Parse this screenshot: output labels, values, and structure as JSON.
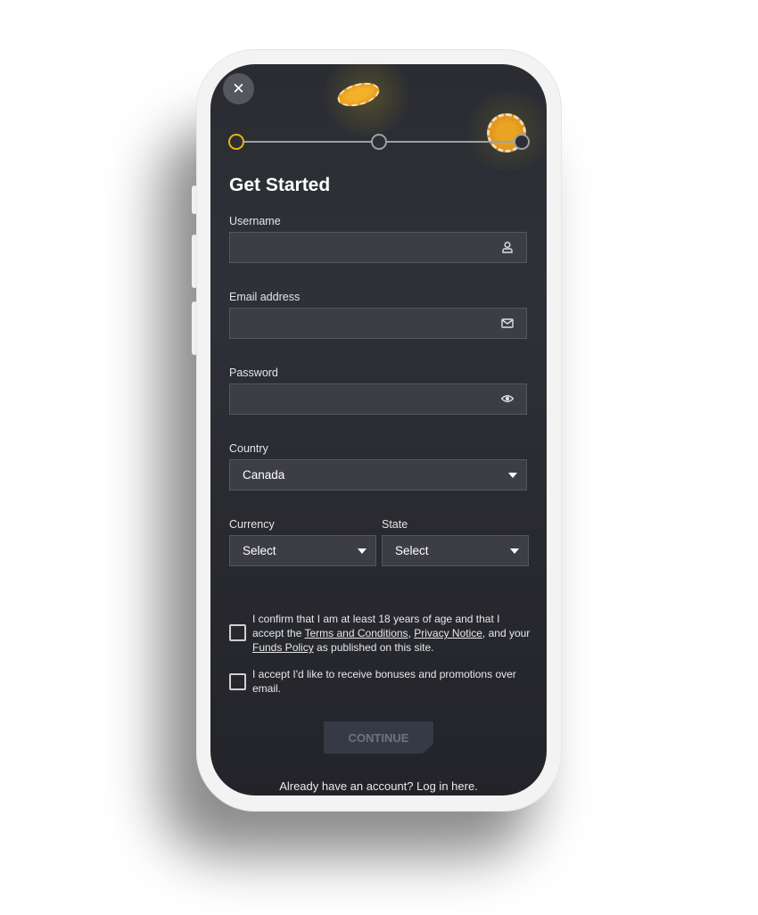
{
  "close_button": {
    "icon": "close-icon",
    "glyph": "✕"
  },
  "stepper": {
    "steps": 3,
    "current_step": 1,
    "active_color": "#e8b415"
  },
  "title": "Get Started",
  "form": {
    "username": {
      "label": "Username",
      "value": "",
      "icon": "user-icon"
    },
    "email": {
      "label": "Email address",
      "value": "",
      "icon": "mail-icon"
    },
    "password": {
      "label": "Password",
      "value": "",
      "icon": "eye-icon"
    },
    "country": {
      "label": "Country",
      "value": "Canada"
    },
    "currency": {
      "label": "Currency",
      "value": "Select"
    },
    "state": {
      "label": "State",
      "value": "Select"
    }
  },
  "consents": {
    "age": {
      "text_1": "I confirm that I am at least 18 years of age and that I accept the ",
      "link_terms": "Terms and Conditions",
      "sep_1": ", ",
      "link_privacy": "Privacy Notice",
      "text_2": ", and your ",
      "link_funds": "Funds Policy",
      "text_3": " as published on this site.",
      "checked": false
    },
    "promotions": {
      "text": "I accept I'd like to receive bonuses and promotions over email.",
      "checked": false
    }
  },
  "continue_label": "CONTINUE",
  "login_prompt": "Already have an account? Log in here."
}
